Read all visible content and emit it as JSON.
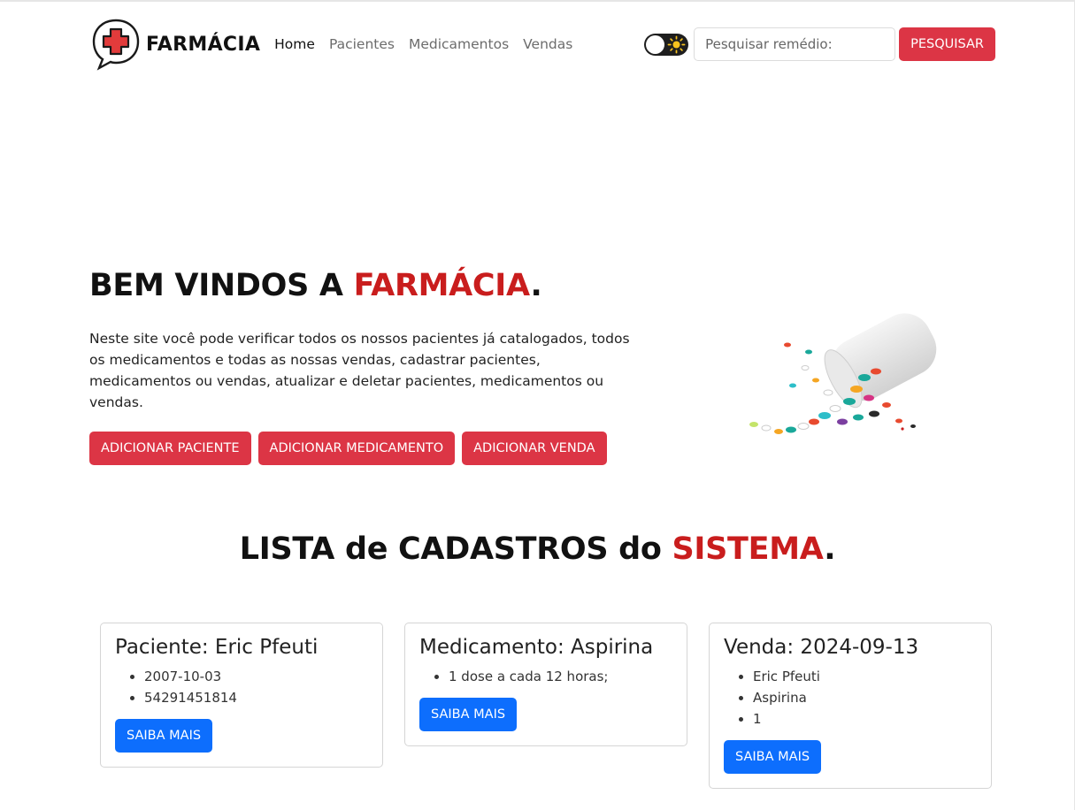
{
  "brand": {
    "name": "FARMÁCIA"
  },
  "nav": {
    "links": [
      "Home",
      "Pacientes",
      "Medicamentos",
      "Vendas"
    ]
  },
  "search": {
    "placeholder": "Pesquisar remédio:",
    "button": "PESQUISAR"
  },
  "hero": {
    "title_prefix": "BEM VINDOS A ",
    "title_accent": "FARMÁCIA",
    "title_suffix": ".",
    "text": "Neste site você pode verificar todos os nossos pacientes já catalogados, todos os medicamentos e todas as nossas vendas, cadastrar pacientes, medicamentos ou vendas, atualizar e deletar pacientes, medicamentos ou vendas.",
    "buttons": [
      "ADICIONAR PACIENTE",
      "ADICIONAR MEDICAMENTO",
      "ADICIONAR VENDA"
    ]
  },
  "section": {
    "title_prefix": "LISTA de CADASTROS do ",
    "title_accent": "SISTEMA",
    "title_suffix": "."
  },
  "cards": [
    {
      "title": "Paciente: Eric Pfeuti",
      "items": [
        "2007-10-03",
        "54291451814"
      ],
      "button": "SAIBA MAIS"
    },
    {
      "title": "Medicamento: Aspirina",
      "items": [
        "1 dose a cada 12 horas;"
      ],
      "button": "SAIBA MAIS"
    },
    {
      "title": "Venda: 2024-09-13",
      "items": [
        "Eric Pfeuti",
        "Aspirina",
        "1"
      ],
      "button": "SAIBA MAIS"
    }
  ],
  "colors": {
    "accent_red": "#dc3545",
    "title_red": "#c91d1d",
    "primary_blue": "#0d6efd"
  },
  "icons": {
    "logo": "medical-cross-chat-icon",
    "theme_toggle": "sun-icon",
    "hero_image": "pill-bottle-image"
  }
}
